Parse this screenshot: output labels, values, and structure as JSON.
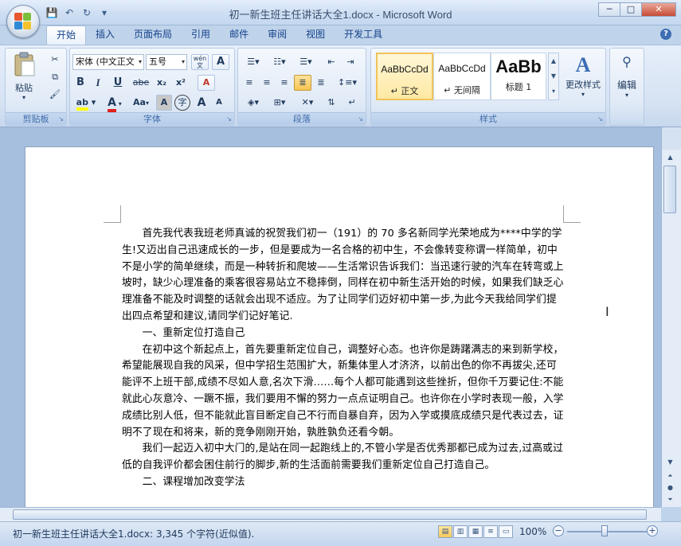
{
  "window": {
    "title": "初一新生班主任讲话大全1.docx - Microsoft Word",
    "min_glyph": "─",
    "max_glyph": "□",
    "close_glyph": "✕"
  },
  "qat": {
    "save": "💾",
    "undo": "↶",
    "redo": "↻",
    "more": "▾"
  },
  "tabs": [
    "开始",
    "插入",
    "页面布局",
    "引用",
    "邮件",
    "审阅",
    "视图",
    "开发工具"
  ],
  "ribbon": {
    "clipboard": {
      "label": "剪贴板",
      "paste": "粘贴"
    },
    "font": {
      "label": "字体",
      "font_name": "宋体 (中文正⽂",
      "font_size": "五号",
      "wen": "wén\n文",
      "a_box": "A",
      "bold": "B",
      "italic": "I",
      "underline": "U",
      "strike": "abe",
      "sub": "x₂",
      "sup": "x²",
      "clear": "A",
      "highlight": "ab",
      "font_color": "A",
      "change_case": "Aa",
      "char_shade": "A",
      "enclose": "字",
      "grow": "A",
      "shrink": "A"
    },
    "paragraph": {
      "label": "段落"
    },
    "styles": {
      "label": "样式",
      "items": [
        {
          "sample": "AaBbCcDd",
          "name": "↵ 正文"
        },
        {
          "sample": "AaBbCcDd",
          "name": "↵ 无间隔"
        },
        {
          "sample": "AaBb",
          "name": "标题 1"
        }
      ],
      "change": "更改样式"
    },
    "editing": {
      "label": "编辑"
    }
  },
  "document": {
    "paragraphs": [
      {
        "indent": true,
        "text": "首先我代表我班老师真诚的祝贺我们初一（191）的 70 多名新同学光荣地成为****中学的学生!又迈出自己迅速成长的一步，但是要成为一名合格的初中生，不会像转变称谓一样简单，初中不是小学的简单继续，而是一种转折和爬坡——生活常识告诉我们：当迅速行驶的汽车在转弯或上坡时，缺少心理准备的乘客很容易站立不稳摔倒，同样在初中新生活开始的时候，如果我们缺乏心理准备不能及时调整的话就会出现不适应。为了让同学们迈好初中第一步,为此今天我给同学们提出四点希望和建议,请同学们记好笔记."
      },
      {
        "indent": true,
        "text": "一、重新定位打造自己"
      },
      {
        "indent": true,
        "text": "在初中这个新起点上，首先要重新定位自己，调整好心态。也许你是踌躇满志的来到新学校，希望能展现自我的风采，但中学招生范围扩大，新集体里人才济济，以前出色的你不再拔尖,还可能评不上班干部,成绩不尽如人意,名次下滑……每个人都可能遇到这些挫折，但你千万要记住:不能就此心灰意冷、一蹶不振，我们要用不懈的努力一点点证明自己。也许你在小学时表现一般，入学成绩比别人低，但不能就此盲目断定自己不行而自暴自弃，因为入学或摸底成绩只是代表过去，证明不了现在和将来，新的竞争刚刚开始，孰胜孰负还看今朝。"
      },
      {
        "indent": true,
        "text": "我们一起迈入初中大门的,是站在同一起跑线上的,不管小学是否优秀那都已成为过去,过高或过低的自我评价都会困住前行的脚步,新的生活面前需要我们重新定位自己打造自己。"
      },
      {
        "indent": true,
        "text": "二、课程增加改变学法"
      }
    ]
  },
  "status": {
    "doc_info": "初一新生班主任讲话大全1.docx: 3,345 个字符(近似值).",
    "zoom": "100%"
  }
}
